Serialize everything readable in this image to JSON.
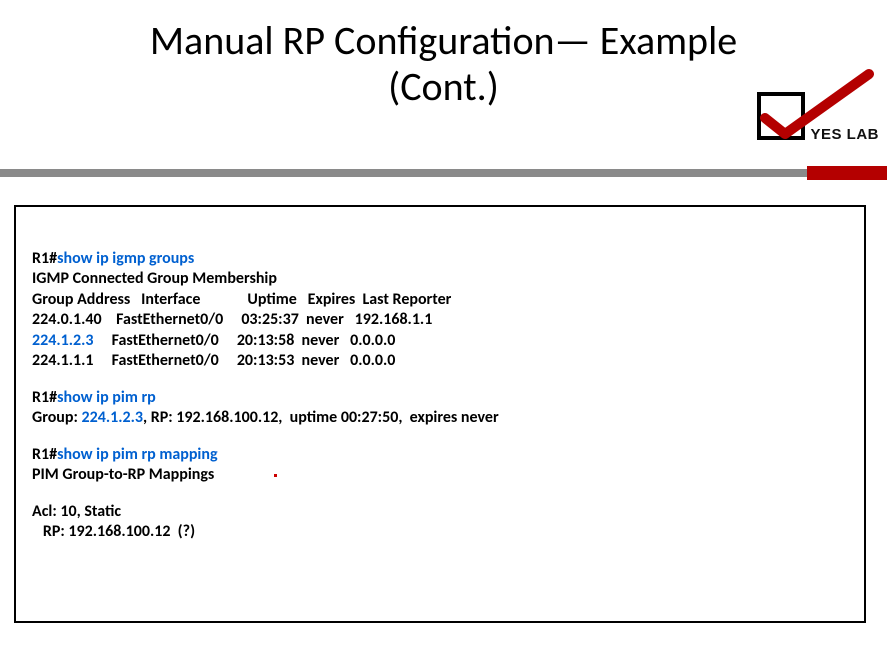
{
  "title_line1": "Manual RP Configuration— Example",
  "title_line2": "(Cont.)",
  "logo_text": "YES LAB",
  "top_fragment": "",
  "cli": {
    "prompt": "R1#",
    "cmd_igmp": "show ip igmp groups",
    "igmp_header": "IGMP Connected Group Membership",
    "igmp_cols": "Group Address   Interface             Uptime   Expires  Last Reporter",
    "igmp_rows": [
      {
        "addr": "224.0.1.40",
        "if": "FastEthernet0/0",
        "up": "03:25:37",
        "exp": "never",
        "rep": "192.168.1.1",
        "hl": false
      },
      {
        "addr": "224.1.2.3",
        "if": "FastEthernet0/0",
        "up": "20:13:58",
        "exp": "never",
        "rep": "0.0.0.0",
        "hl": true
      },
      {
        "addr": "224.1.1.1",
        "if": "FastEthernet0/0",
        "up": "20:13:53",
        "exp": "never",
        "rep": "0.0.0.0",
        "hl": false
      }
    ],
    "cmd_rp": "show ip pim rp",
    "rp_line_pre": "Group: ",
    "rp_group": "224.1.2.3",
    "rp_line_post": ", RP: 192.168.100.12,  uptime 00:27:50,  expires never",
    "cmd_rp_map": "show ip pim rp mapping",
    "map_header": "PIM Group-to-RP Mappings",
    "acl_line": "Acl: 10, Static",
    "rp_map_line": "   RP: 192.168.100.12  (?)"
  }
}
